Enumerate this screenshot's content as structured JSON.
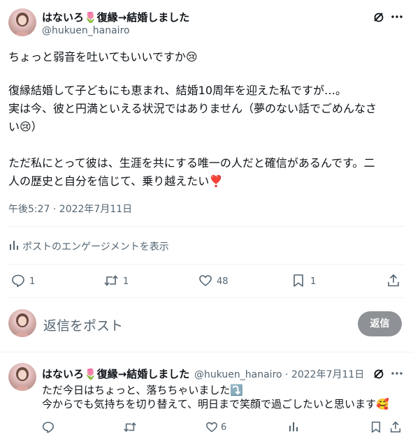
{
  "main_tweet": {
    "display_name": "はないろ🌷復縁→結婚しました",
    "handle": "@hukuen_hanairo",
    "text_line1": "ちょっと弱音を吐いてもいいですか😢",
    "text_para2_l1": "復縁結婚して子どもにも恵まれ、結婚10周年を迎えた私ですが…。",
    "text_para2_l2": "実は今、彼と円満といえる状況ではありません（夢のない話でごめんなさ",
    "text_para2_l3": "い😢）",
    "text_para3_l1": "ただ私にとって彼は、生涯を共にする唯一の人だと確信があるんです。二",
    "text_para3_l2": "人の歴史と自分を信じて、乗り越えたい❣️",
    "timestamp": "午後5:27 · 2022年7月11日",
    "engagement_label": "ポストのエンゲージメントを表示",
    "counts": {
      "replies": "1",
      "retweets": "1",
      "likes": "48",
      "bookmarks": "1"
    }
  },
  "reply_composer": {
    "placeholder": "返信をポスト",
    "button_label": "返信"
  },
  "reply_tweet": {
    "display_name": "はないろ🌷復縁→結婚しました",
    "handle_date": "@hukuen_hanairo · 2022年7月11日",
    "text_line1": "ただ今日はちょっと、落ちちゃいました⤵️",
    "text_line2": "今からでも気持ちを切り替えて、明日まで笑顔で過ごしたいと思います🥰",
    "counts": {
      "likes": "6"
    }
  },
  "colors": {
    "text": "#0f1419",
    "secondary": "#536471",
    "divider": "#eff3f4",
    "reply_button": "#8e9296"
  },
  "icons": [
    "grok-icon",
    "more-icon",
    "reply-icon",
    "retweet-icon",
    "like-icon",
    "bookmark-icon",
    "share-icon",
    "analytics-icon"
  ]
}
